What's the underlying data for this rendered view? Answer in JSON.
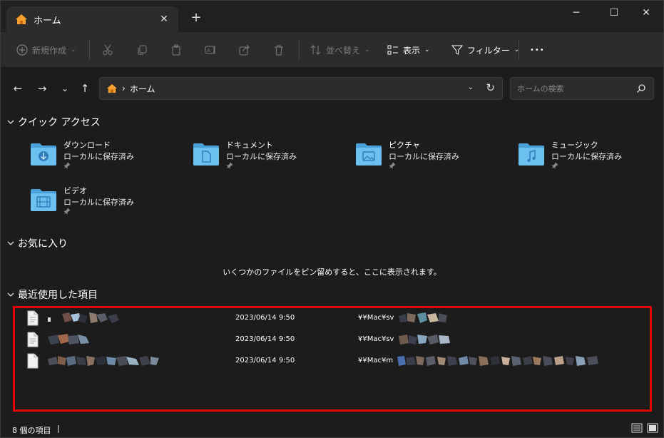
{
  "tab": {
    "title": "ホーム",
    "close": "✕",
    "new_tab": "+"
  },
  "window_controls": {
    "minimize": "─",
    "maximize": "☐",
    "close": "✕"
  },
  "toolbar": {
    "new_label": "新規作成",
    "sort_label": "並べ替え",
    "view_label": "表示",
    "filter_label": "フィルター",
    "more_label": "•••"
  },
  "nav": {
    "back": "←",
    "forward": "→",
    "recent": "⌄",
    "up": "↑",
    "address_text": "ホーム",
    "address_sep": "›",
    "search_placeholder": "ホームの検索"
  },
  "sections": {
    "quick_access": "クイック アクセス",
    "favorites": "お気に入り",
    "recent": "最近使用した項目"
  },
  "quick_access_items": [
    {
      "name": "ダウンロード",
      "sub": "ローカルに保存済み",
      "icon": "download-folder-icon"
    },
    {
      "name": "ドキュメント",
      "sub": "ローカルに保存済み",
      "icon": "documents-folder-icon"
    },
    {
      "name": "ピクチャ",
      "sub": "ローカルに保存済み",
      "icon": "pictures-folder-icon"
    },
    {
      "name": "ミュージック",
      "sub": "ローカルに保存済み",
      "icon": "music-folder-icon"
    },
    {
      "name": "ビデオ",
      "sub": "ローカルに保存済み",
      "icon": "videos-folder-icon"
    }
  ],
  "favorites_empty": "いくつかのファイルをピン留めすると、ここに表示されます。",
  "recent_files": [
    {
      "date": "2023/06/14 9:50",
      "location": "¥¥Mac¥sv"
    },
    {
      "date": "2023/06/14 9:50",
      "location": "¥¥Mac¥sv"
    },
    {
      "date": "2023/06/14 9:50",
      "location": "¥¥Mac¥m"
    }
  ],
  "status": {
    "count": "8 個の項目",
    "cursor": "|"
  },
  "colors": {
    "accent": "#60b8f0",
    "highlight": "#e00000",
    "background": "#1c1c1c",
    "toolbar": "#2c2c2c"
  }
}
